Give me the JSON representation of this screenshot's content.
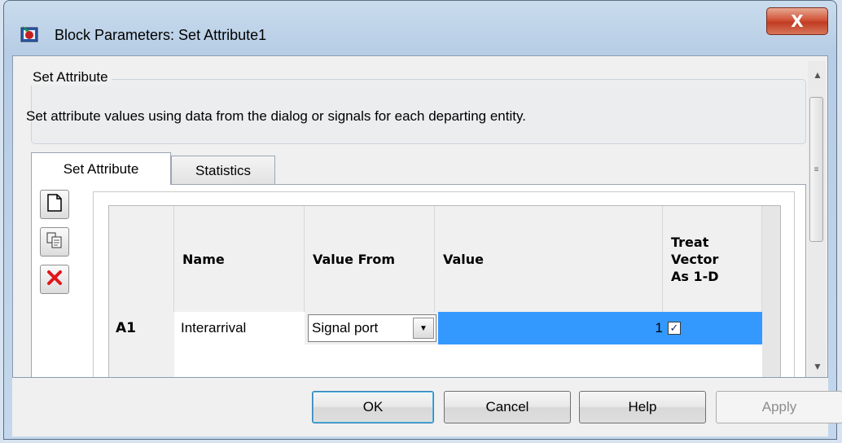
{
  "window": {
    "title": "Block Parameters: Set Attribute1",
    "close_glyph": "X"
  },
  "group": {
    "title": "Set Attribute",
    "description": "Set attribute values using data from the dialog or signals for each departing entity."
  },
  "tabs": [
    {
      "label": "Set Attribute",
      "active": true
    },
    {
      "label": "Statistics",
      "active": false
    }
  ],
  "side_buttons": [
    {
      "name": "add-attribute",
      "icon": "new-document-icon"
    },
    {
      "name": "copy-attribute",
      "icon": "copy-icon"
    },
    {
      "name": "delete-attribute",
      "icon": "delete-x-icon"
    }
  ],
  "table": {
    "columns": [
      "Name",
      "Value From",
      "Value",
      "Treat\nVector\nAs 1-D"
    ],
    "rows": [
      {
        "id": "A1",
        "name": "Interarrival",
        "value_from": "Signal port",
        "value": "1",
        "treat_vector_as_1d": true
      }
    ]
  },
  "buttons": {
    "ok": "OK",
    "cancel": "Cancel",
    "help": "Help",
    "apply": "Apply"
  },
  "colors": {
    "selection": "#3399ff",
    "close_button": "#c9452a"
  }
}
